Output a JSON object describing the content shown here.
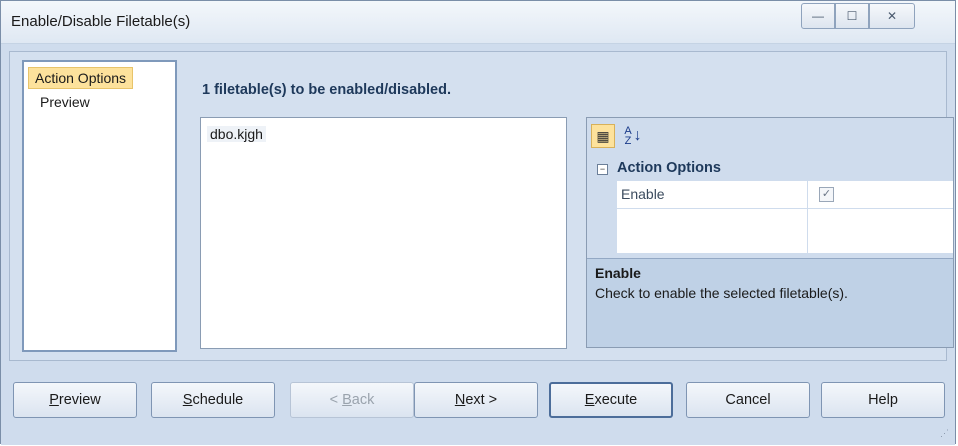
{
  "window": {
    "title": "Enable/Disable Filetable(s)",
    "min_glyph": "—",
    "max_glyph": "☐",
    "close_glyph": "✕"
  },
  "nav": {
    "items": [
      {
        "label": "Action Options",
        "selected": true
      },
      {
        "label": "Preview",
        "selected": false
      }
    ]
  },
  "main": {
    "heading": "1 filetable(s) to be enabled/disabled.",
    "list_items": [
      "dbo.kjgh"
    ]
  },
  "property_grid": {
    "toolbar": {
      "categorized_icon": "categorized-icon",
      "alphabetical_icon": "sort-az-icon",
      "categorized_glyph": "▦",
      "az_top": "A",
      "az_bottom": "Z"
    },
    "category": {
      "label": "Action Options",
      "collapse_glyph": "−"
    },
    "properties": [
      {
        "name": "Enable",
        "checked": true,
        "check_glyph": "✓"
      }
    ],
    "description": {
      "title": "Enable",
      "text": "Check to enable the selected filetable(s)."
    }
  },
  "buttons": {
    "preview": {
      "pre": "",
      "u": "P",
      "post": "review"
    },
    "schedule": {
      "pre": "",
      "u": "S",
      "post": "chedule"
    },
    "back": {
      "pre": "< ",
      "u": "B",
      "post": "ack"
    },
    "next": {
      "pre": "",
      "u": "N",
      "post": "ext >"
    },
    "execute": {
      "pre": "",
      "u": "E",
      "post": "xecute"
    },
    "cancel": "Cancel",
    "help": "Help"
  },
  "colors": {
    "selection": "#fde29c",
    "frame": "#cfdced",
    "text_heading": "#1e395b"
  }
}
